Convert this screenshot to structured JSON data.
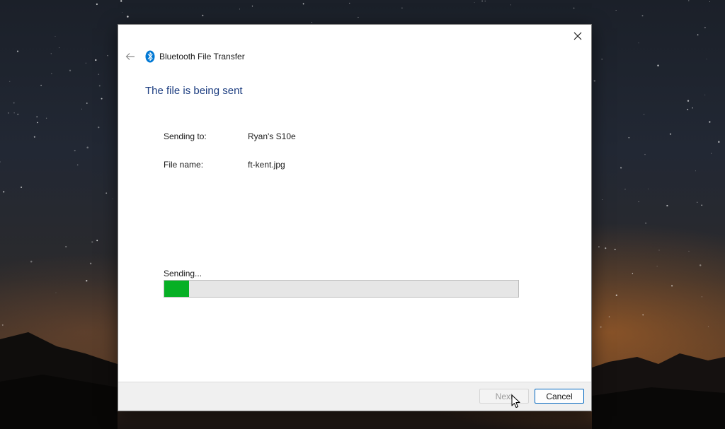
{
  "window": {
    "title": "Bluetooth File Transfer",
    "heading": "The file is being sent"
  },
  "details": {
    "sending_to_label": "Sending to:",
    "sending_to_value": "Ryan's S10e",
    "file_name_label": "File name:",
    "file_name_value": "ft-kent.jpg"
  },
  "progress": {
    "status": "Sending...",
    "fraction": 0.07
  },
  "buttons": {
    "next": "Next",
    "cancel": "Cancel"
  },
  "icons": {
    "back": "arrow-left-icon",
    "bluetooth": "bluetooth-icon",
    "close": "close-icon",
    "cursor": "mouse-pointer-icon"
  },
  "colors": {
    "heading": "#1c3d80",
    "progress_fill": "#06b025",
    "bluetooth": "#0078d4",
    "cancel_border": "#0067c0"
  }
}
